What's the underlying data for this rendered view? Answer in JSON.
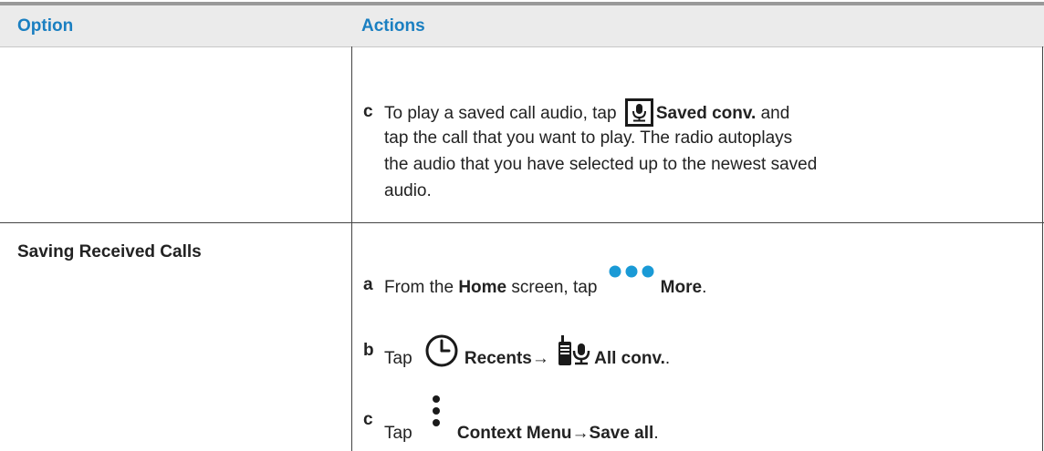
{
  "table": {
    "header": {
      "option": "Option",
      "actions": "Actions"
    },
    "row1": {
      "option": "",
      "step_c": {
        "letter": "c",
        "l1a": "To play a saved call audio, tap",
        "l1b": "Saved conv.",
        "l1c": " and",
        "l2": "tap the call that you want to play. The radio autoplays",
        "l3": "the audio that you have selected up to the newest saved",
        "l4": "audio."
      }
    },
    "row2": {
      "option": "Saving Received Calls",
      "step_a": {
        "letter": "a",
        "t1": "From the ",
        "t2": "Home",
        "t3": " screen, tap",
        "t4": "More",
        "t5": "."
      },
      "step_b": {
        "letter": "b",
        "t1": "Tap",
        "t2": "Recents",
        "t3": "→",
        "t4": "All conv.",
        "t5": "."
      },
      "step_c": {
        "letter": "c",
        "t1": "Tap",
        "t2": "Context Menu",
        "t3": "→",
        "t4": "Save all",
        "t5": "."
      }
    }
  },
  "icons": {
    "saved_conv": "microphone-box-icon",
    "more": "three-dots-icon",
    "recents": "clock-icon",
    "all_conv": "radio-microphone-icon",
    "context_menu": "vertical-dots-icon"
  },
  "colors": {
    "header_text": "#1a7fc1",
    "dots": "#1a9ad6",
    "header_bg": "#ebebeb"
  }
}
